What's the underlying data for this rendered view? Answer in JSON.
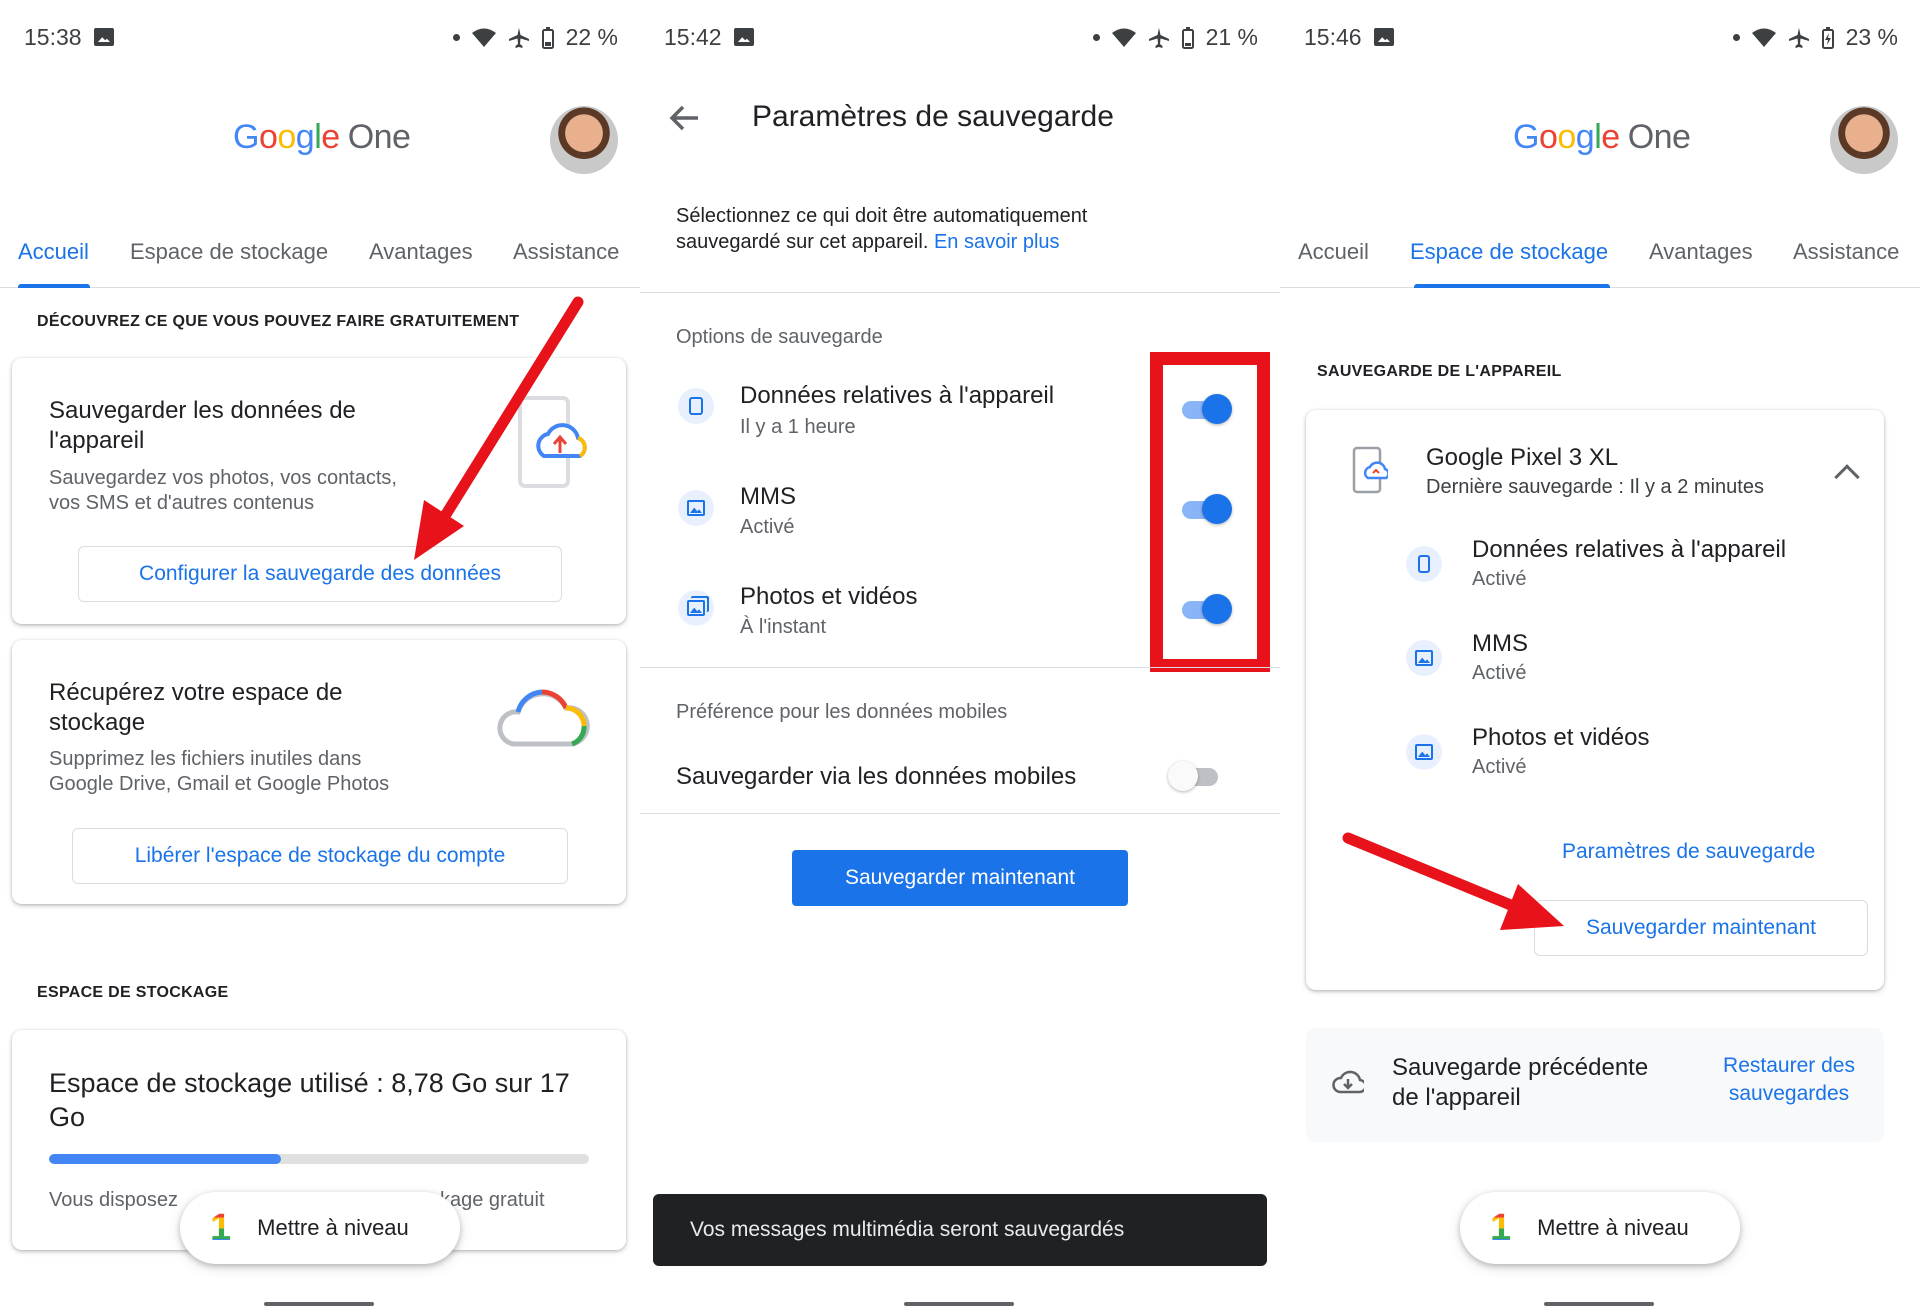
{
  "panels": [
    {
      "status": {
        "time": "15:38",
        "battery": "22 %"
      },
      "logo": {
        "g1": "G",
        "g2": "o",
        "g3": "o",
        "g4": "g",
        "g5": "l",
        "g6": "e",
        "one": "One"
      },
      "tabs": [
        "Accueil",
        "Espace de stockage",
        "Avantages",
        "Assistance"
      ],
      "section1": "DÉCOUVREZ CE QUE VOUS POUVEZ FAIRE GRATUITEMENT",
      "backup_card": {
        "title_line1": "Sauvegarder les données de",
        "title_line2": "l'appareil",
        "sub_line1": "Sauvegardez vos photos, vos contacts,",
        "sub_line2": "vos SMS et d'autres contenus",
        "button": "Configurer la sauvegarde des données"
      },
      "storage_card": {
        "title_line1": "Récupérez votre espace de",
        "title_line2": "stockage",
        "sub_line1": "Supprimez les fichiers inutiles dans",
        "sub_line2": "Google Drive, Gmail et Google Photos",
        "button": "Libérer l'espace de stockage du compte"
      },
      "section2": "ESPACE DE STOCKAGE",
      "usage_card": {
        "title_line1": "Espace de stockage utilisé : 8,78 Go sur 17",
        "title_line2": "Go",
        "progress_fraction": 0.43,
        "footer_left": "Vous disposez",
        "footer_right": "kage gratuit"
      },
      "fab": {
        "icon": "1",
        "label": "Mettre à niveau"
      }
    },
    {
      "status": {
        "time": "15:42",
        "battery": "21 %"
      },
      "title": "Paramètres de sauvegarde",
      "intro_line1": "Sélectionnez ce qui doit être automatiquement",
      "intro_line2": "sauvegardé sur cet appareil.",
      "intro_link": "En savoir plus",
      "options_label": "Options de sauvegarde",
      "options": [
        {
          "title": "Données relatives à l'appareil",
          "sub": "Il y a 1 heure",
          "icon": "phone-icon",
          "on": true
        },
        {
          "title": "MMS",
          "sub": "Activé",
          "icon": "image-icon",
          "on": true
        },
        {
          "title": "Photos et vidéos",
          "sub": "À l'instant",
          "icon": "photos-icon",
          "on": true
        }
      ],
      "mobile_label": "Préférence pour les données mobiles",
      "mobile_option": "Sauvegarder via les données mobiles",
      "mobile_on": false,
      "button": "Sauvegarder maintenant",
      "snackbar": "Vos messages multimédia seront sauvegardés"
    },
    {
      "status": {
        "time": "15:46",
        "battery": "23 %"
      },
      "logo": {
        "g1": "G",
        "g2": "o",
        "g3": "o",
        "g4": "g",
        "g5": "l",
        "g6": "e",
        "one": "One"
      },
      "tabs": [
        "Accueil",
        "Espace de stockage",
        "Avantages",
        "Assistance"
      ],
      "section": "SAUVEGARDE DE L'APPAREIL",
      "device": {
        "name": "Google Pixel 3 XL",
        "last": "Dernière sauvegarde : Il y a 2 minutes"
      },
      "items": [
        {
          "title": "Données relatives à l'appareil",
          "sub": "Activé"
        },
        {
          "title": "MMS",
          "sub": "Activé"
        },
        {
          "title": "Photos et vidéos",
          "sub": "Activé"
        }
      ],
      "settings_link": "Paramètres de sauvegarde",
      "backup_button": "Sauvegarder maintenant",
      "previous": {
        "line1": "Sauvegarde précédente",
        "line2": "de l'appareil",
        "restore_line1": "Restaurer des",
        "restore_line2": "sauvegardes"
      },
      "fab": {
        "icon": "1",
        "label": "Mettre à niveau"
      }
    }
  ],
  "colors": {
    "accent": "#1a73e8",
    "annotation_red": "#e8121a"
  }
}
